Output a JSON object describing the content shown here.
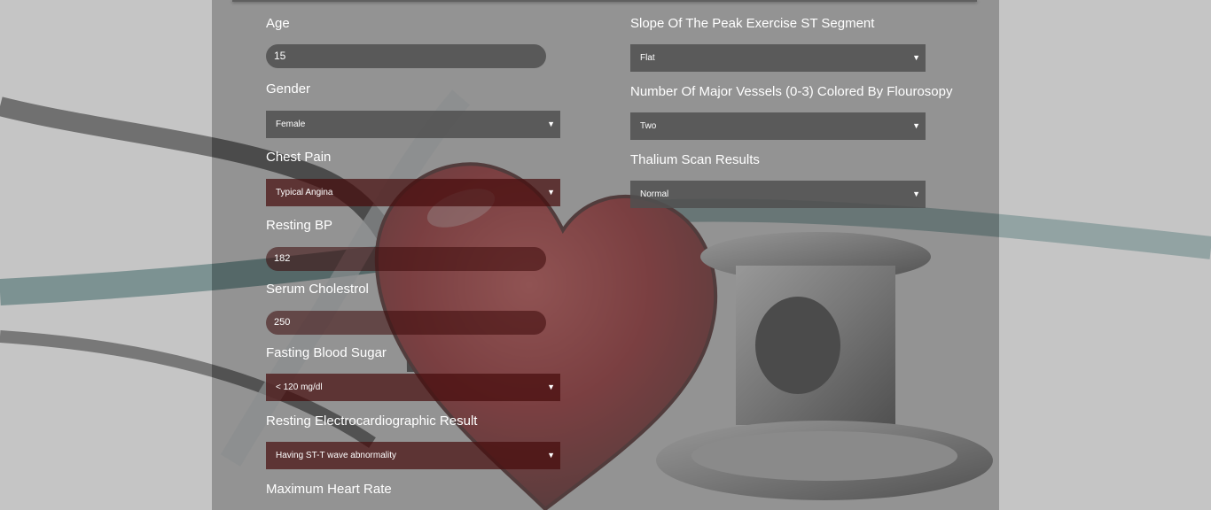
{
  "left_column": {
    "age": {
      "label": "Age",
      "value": "15"
    },
    "gender": {
      "label": "Gender",
      "value": "Female"
    },
    "chest_pain": {
      "label": "Chest Pain",
      "value": "Typical Angina"
    },
    "resting_bp": {
      "label": "Resting BP",
      "value": "182"
    },
    "serum_cholestrol": {
      "label": "Serum Cholestrol",
      "value": "250"
    },
    "fasting_blood_sugar": {
      "label": "Fasting Blood Sugar",
      "value": "< 120 mg/dl"
    },
    "resting_ecg": {
      "label": "Resting Electrocardiographic Result",
      "value": "Having ST-T wave abnormality"
    },
    "max_heart_rate": {
      "label": "Maximum Heart Rate"
    }
  },
  "right_column": {
    "slope": {
      "label": "Slope Of The Peak Exercise ST Segment",
      "value": "Flat"
    },
    "vessels": {
      "label": "Number Of Major Vessels (0-3) Colored By Flourosopy",
      "value": "Two"
    },
    "thalium": {
      "label": "Thalium Scan Results",
      "value": "Normal"
    }
  },
  "icons": {
    "dropdown": "caret-down-icon",
    "background": "heart-stethoscope-image"
  },
  "colors": {
    "heart": "#a80d12",
    "panel": "#5f5f5f",
    "text": "#ffffff"
  }
}
